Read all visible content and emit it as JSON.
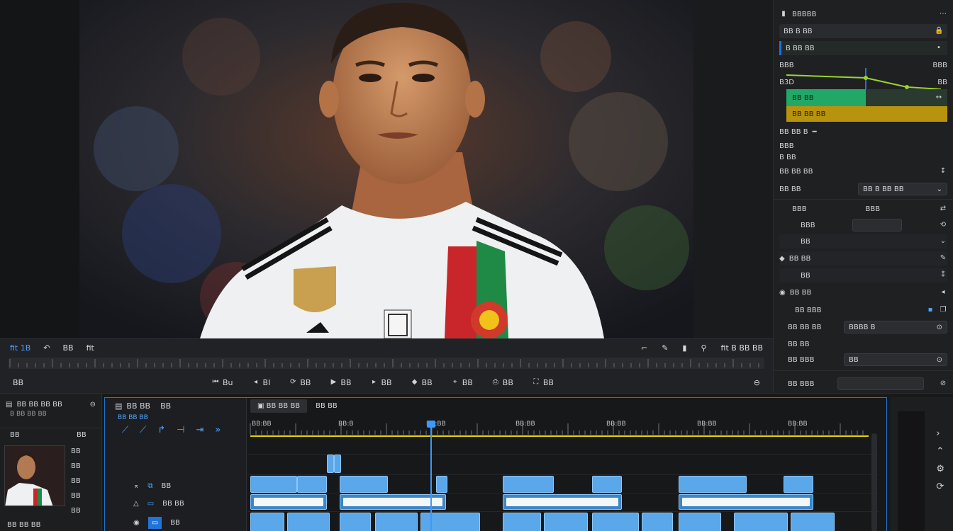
{
  "viewer": {
    "toolbar_left_a": "fit 1B",
    "toolbar_left_b": "BB",
    "toolbar_left_c": "fit",
    "toolbar_right": "fit B BB BB",
    "controls": [
      "Bu",
      "BI",
      "BB",
      "BB",
      "BB",
      "BB",
      "BB",
      "BB",
      "BB"
    ],
    "bottom_left": "BB"
  },
  "inspector": {
    "top_title": "BBBBB",
    "row1": "BB B BB",
    "row2": "B BB BB",
    "row3": "BBB",
    "row3_val": "BBB",
    "row4_left": "B3D",
    "row4_right": "BB",
    "row5": "BB BB",
    "row6": "BB BB BB",
    "row7": "BB BB B",
    "row8": "BBB",
    "row9": "B BB",
    "row10": "BB BB BB",
    "row11_left": "BB BB",
    "row11_field": "BB B BB BB",
    "row12_left": "BBB",
    "row12_right": "BBB",
    "row13_left": "BBB",
    "row14": "BB",
    "row15": "BB BB",
    "row16": "BB",
    "row17": "BB BB",
    "row18": "BB BBB",
    "row19_left": "BB BB BB",
    "row19_field": "BBBB B",
    "row20": "BB BB",
    "row21_left": "BB BBB",
    "row21_field": "BB",
    "row22_left": "BB BBB",
    "accent_green": "#22a866",
    "accent_gold": "#b8930e"
  },
  "media": {
    "title": "BB BB BB BB",
    "sub": "B BB BB BB",
    "left_label": "BB",
    "right_label": "BB",
    "side_items": [
      "BB",
      "BB",
      "BB",
      "BB",
      "BB"
    ],
    "bottom": "BB BB BB"
  },
  "timeline": {
    "head_title": "BB BB",
    "head_title_b": "BB",
    "head_sub": "BB BB BB",
    "tab1": "BB BB BB",
    "tab2": "BB BB",
    "ruler": [
      "BB:BB",
      "BB:B",
      "BB:BB",
      "BB:BB",
      "BB:BB",
      "BB:BB",
      "BB:BB"
    ],
    "track_labels": [
      "BB",
      "BB BB",
      "BB"
    ],
    "accent_blue": "#1f73d9",
    "accent_yellow": "#e6d600"
  }
}
